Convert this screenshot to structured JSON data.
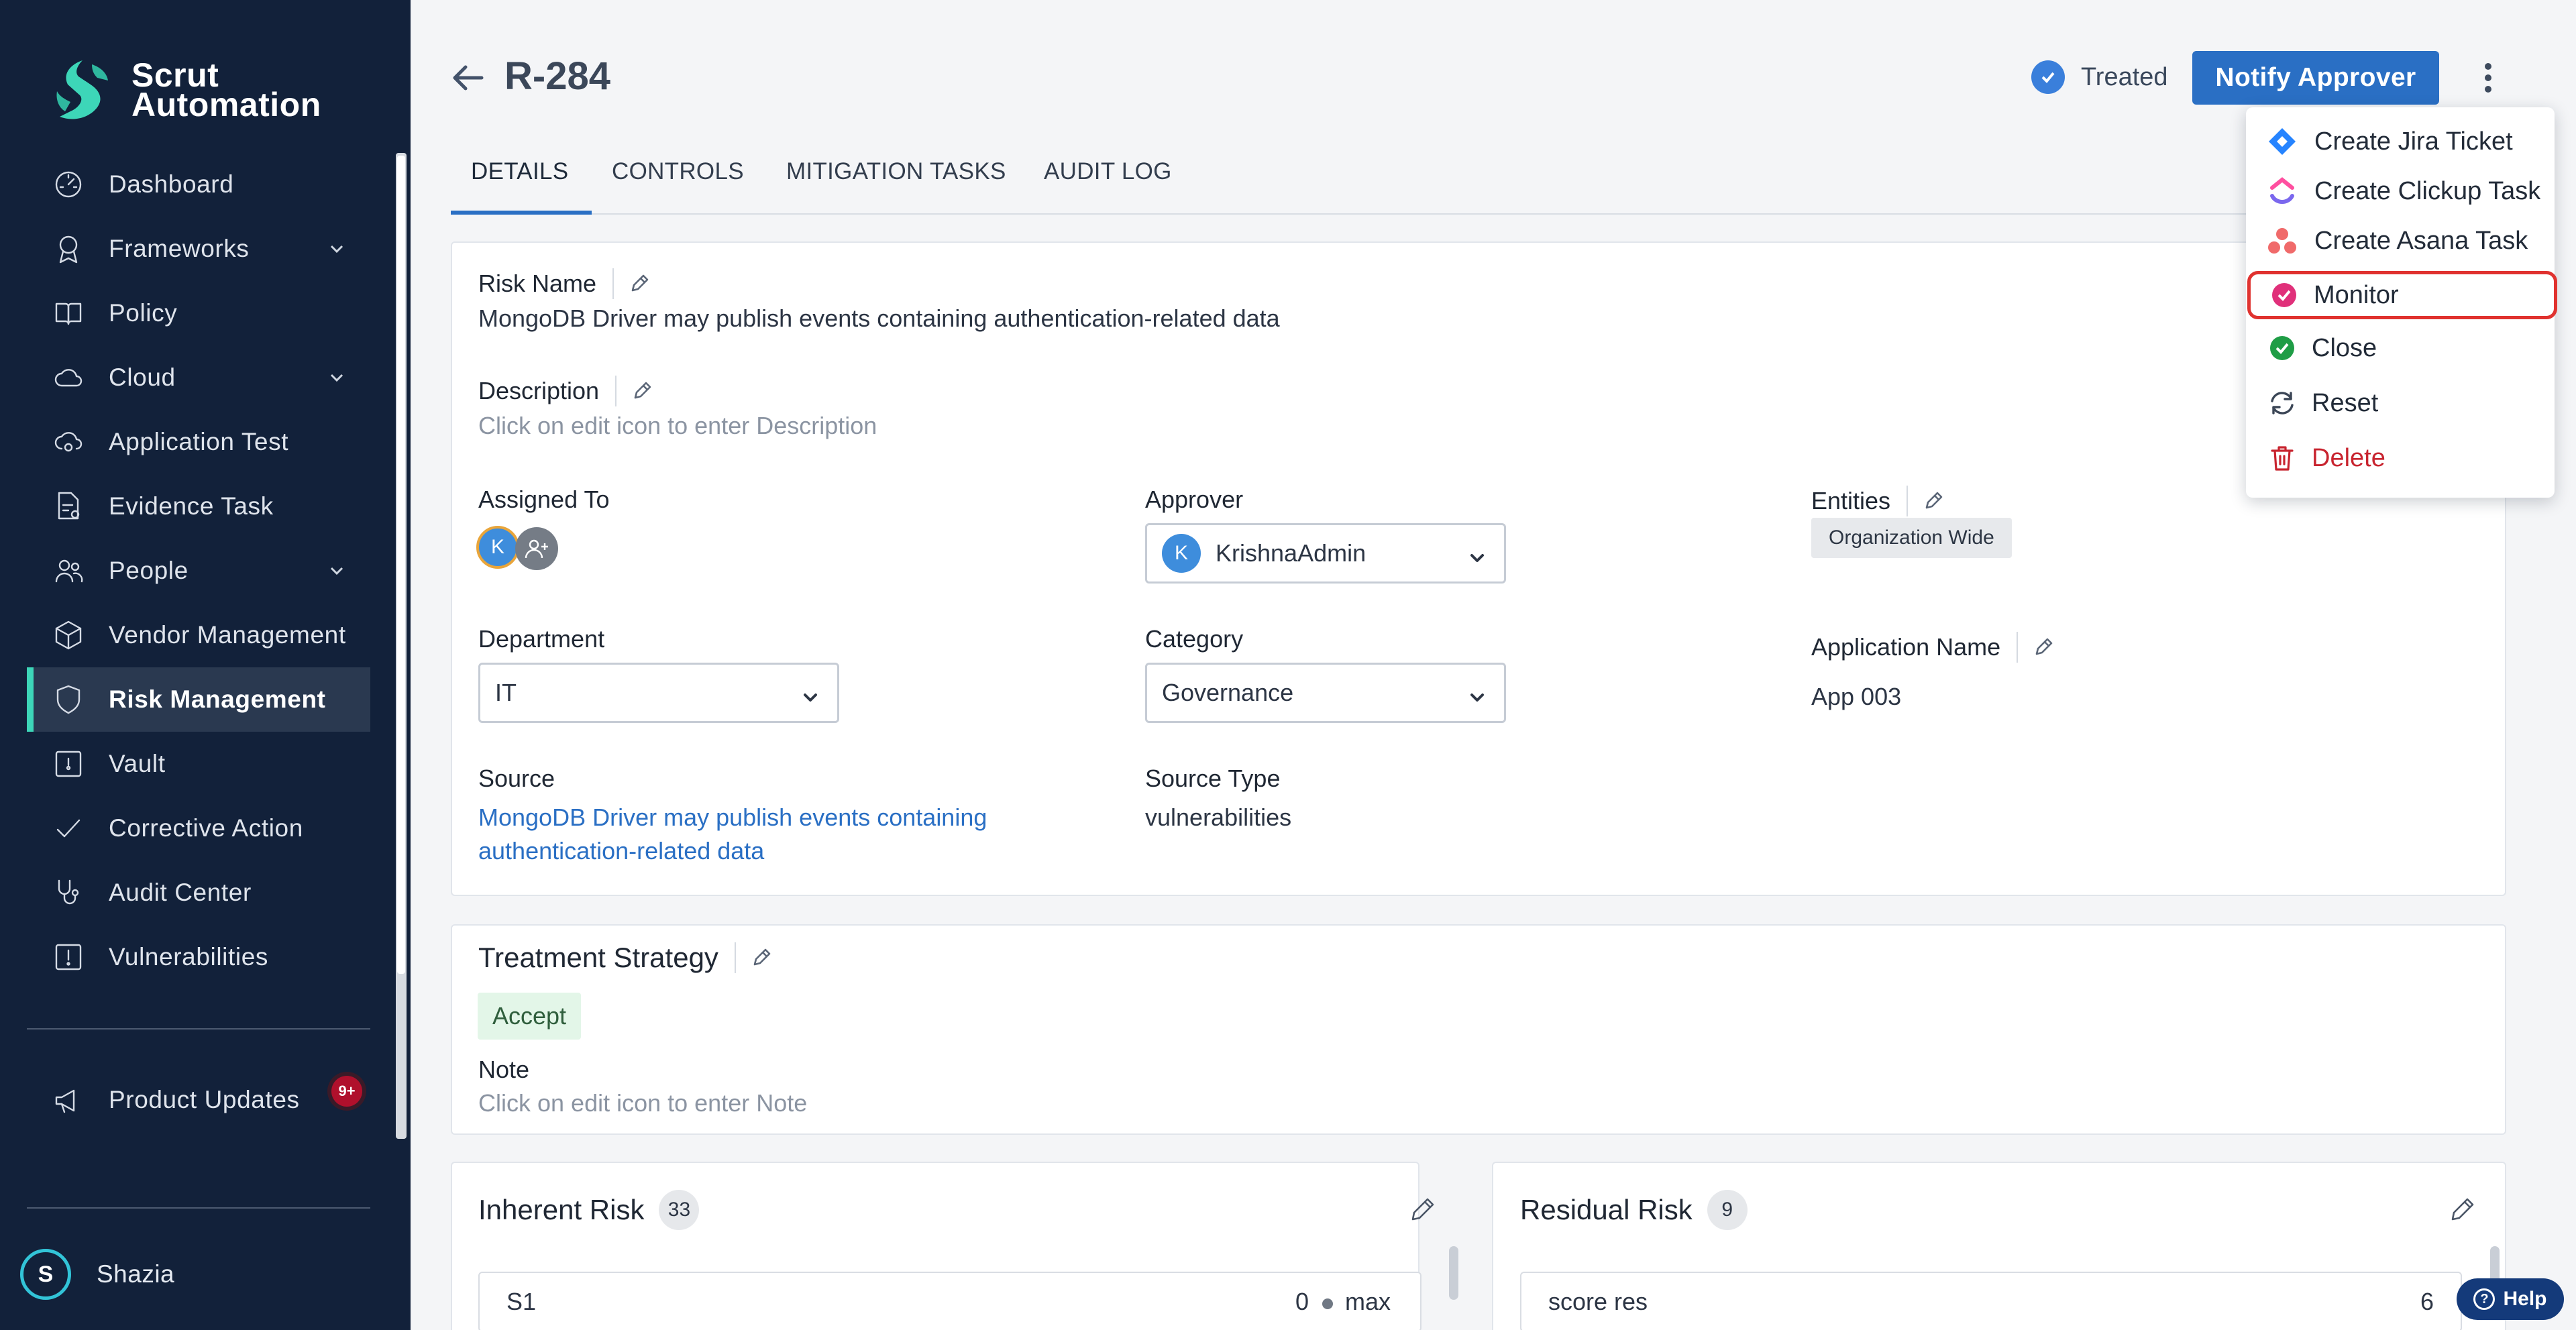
{
  "brand": {
    "line1": "Scrut",
    "line2": "Automation",
    "accent": "#3dd6b8"
  },
  "sidebar": {
    "items": [
      {
        "label": "Dashboard",
        "icon": "dashboard-icon"
      },
      {
        "label": "Frameworks",
        "icon": "award-icon",
        "has_children": true
      },
      {
        "label": "Policy",
        "icon": "book-icon"
      },
      {
        "label": "Cloud",
        "icon": "cloud-icon",
        "has_children": true
      },
      {
        "label": "Application Test",
        "icon": "cloud-test-icon"
      },
      {
        "label": "Evidence Task",
        "icon": "evidence-icon"
      },
      {
        "label": "People",
        "icon": "people-icon",
        "has_children": true
      },
      {
        "label": "Vendor Management",
        "icon": "box-icon"
      },
      {
        "label": "Risk Management",
        "icon": "shield-icon",
        "active": true
      },
      {
        "label": "Vault",
        "icon": "vault-icon"
      },
      {
        "label": "Corrective Action",
        "icon": "check-icon"
      },
      {
        "label": "Audit Center",
        "icon": "stethoscope-icon"
      },
      {
        "label": "Vulnerabilities",
        "icon": "alert-icon"
      }
    ],
    "product_updates": {
      "label": "Product Updates",
      "badge": "9+"
    },
    "user": {
      "initial": "S",
      "name": "Shazia"
    }
  },
  "header": {
    "risk_id": "R-284",
    "status": "Treated",
    "notify_button": "Notify Approver"
  },
  "tabs": [
    "DETAILS",
    "CONTROLS",
    "MITIGATION TASKS",
    "AUDIT LOG"
  ],
  "details": {
    "risk_name_label": "Risk Name",
    "risk_name": "MongoDB Driver may publish events containing authentication-related data",
    "description_label": "Description",
    "description_placeholder": "Click on edit icon to enter Description",
    "assigned_to_label": "Assigned To",
    "assignee_initial": "K",
    "approver_label": "Approver",
    "approver_initial": "K",
    "approver": "KrishnaAdmin",
    "entities_label": "Entities",
    "entity": "Organization Wide",
    "department_label": "Department",
    "department": "IT",
    "category_label": "Category",
    "category": "Governance",
    "application_name_label": "Application Name",
    "application_name": "App 003",
    "source_label": "Source",
    "source_line1": "MongoDB Driver may publish events containing",
    "source_line2": "authentication-related data",
    "source_type_label": "Source Type",
    "source_type": "vulnerabilities"
  },
  "treatment": {
    "title": "Treatment Strategy",
    "strategy": "Accept",
    "note_label": "Note",
    "note_placeholder": "Click on edit icon to enter Note"
  },
  "inherent_risk": {
    "title": "Inherent Risk",
    "score": "33",
    "row_label": "S1",
    "row_value": "0",
    "row_max": "max"
  },
  "residual_risk": {
    "title": "Residual Risk",
    "score": "9",
    "row_label": "score res",
    "row_value": "6"
  },
  "menu": {
    "items": [
      {
        "label": "Create Jira Ticket",
        "icon": "jira-icon"
      },
      {
        "label": "Create Clickup Task",
        "icon": "clickup-icon"
      },
      {
        "label": "Create Asana Task",
        "icon": "asana-icon"
      },
      {
        "label": "Monitor",
        "icon": "monitor-check-icon",
        "highlighted": true
      },
      {
        "label": "Close",
        "icon": "close-check-icon"
      },
      {
        "label": "Reset",
        "icon": "reset-icon"
      },
      {
        "label": "Delete",
        "icon": "trash-icon",
        "danger": true
      }
    ]
  },
  "help": {
    "label": "Help"
  }
}
